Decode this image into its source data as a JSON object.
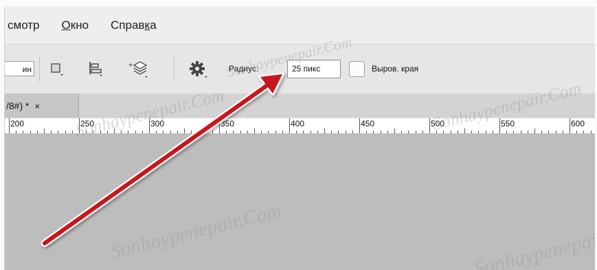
{
  "menu": {
    "items": [
      {
        "label": "смотр"
      },
      {
        "label": "Окно"
      },
      {
        "label": "Справка"
      }
    ]
  },
  "options": {
    "cut_field_value": "ин",
    "radius_label": "Радиус:",
    "radius_value": "25 пикс",
    "smooth_label": "Выров. края"
  },
  "tab": {
    "title": "/8#) *",
    "close": "×"
  },
  "ruler": {
    "numbers": [
      "200",
      "250",
      "300",
      "350",
      "400",
      "450",
      "500",
      "550",
      "600"
    ]
  },
  "watermark": {
    "text": "Sonhaypenepair.Com"
  },
  "colors": {
    "arrow": "#c9151b",
    "canvas": "#bdbdbd"
  },
  "icons": [
    "rectangle-icon",
    "align-icon",
    "arrange-layers-icon",
    "gear-icon"
  ]
}
